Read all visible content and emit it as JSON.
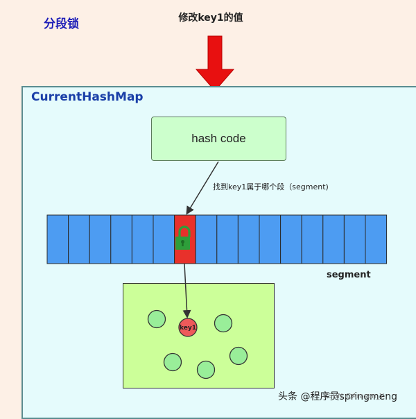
{
  "title": "分段锁",
  "top_label": "修改key1的值",
  "map_title": "CurrentHashMap",
  "hash_box_label": "hash code",
  "find_label": "找到key1属于哪个段（segment)",
  "segment_label": "segment",
  "key_label": "key1",
  "segments": {
    "count": 16,
    "locked_index": 6
  },
  "nodes": {
    "count": 6,
    "highlighted": "key1"
  },
  "watermark": "头条 @程序员springmeng",
  "watermark_csdn": "CSDN @Arasan_Y",
  "colors": {
    "segment_fill": "#4d9cf2",
    "segment_locked": "#e8312b",
    "lock_icon": "#2e9e3a",
    "node_fill": "#99ee99",
    "key_node_fill": "#ee5a5a",
    "arrow_red": "#e81010"
  }
}
